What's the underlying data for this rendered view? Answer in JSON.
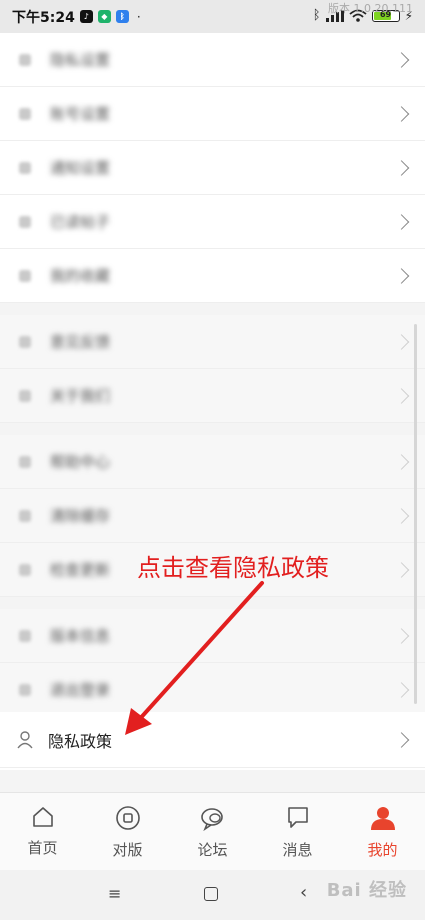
{
  "status_bar": {
    "time": "下午5:24",
    "battery": "69",
    "version": "版本 1.0.20.111",
    "notif_colors": [
      "#111111",
      "#1fb36b",
      "#2f80ed"
    ]
  },
  "menu": {
    "group1": [
      "隐私设置",
      "账号设置",
      "通知设置",
      "已读帖子",
      "我的收藏"
    ],
    "group2": [
      "意见反馈",
      "关于我们"
    ],
    "group3": [
      "帮助中心",
      "清除缓存",
      "检查更新"
    ],
    "group4": [
      "版本信息",
      "退出登录"
    ]
  },
  "privacy_item": {
    "label": "隐私政策",
    "icon": "user-outline-icon"
  },
  "annotation": {
    "text": "点击查看隐私政策",
    "color": "#e21f1f"
  },
  "tabbar": {
    "tabs": [
      {
        "label": "首页",
        "icon": "home-icon"
      },
      {
        "label": "对版",
        "icon": "circle-square-icon"
      },
      {
        "label": "论坛",
        "icon": "chat-bubbles-icon"
      },
      {
        "label": "消息",
        "icon": "message-icon"
      },
      {
        "label": "我的",
        "icon": "person-icon"
      }
    ],
    "active_color": "#e8442d"
  },
  "watermark": "Bai 经验"
}
